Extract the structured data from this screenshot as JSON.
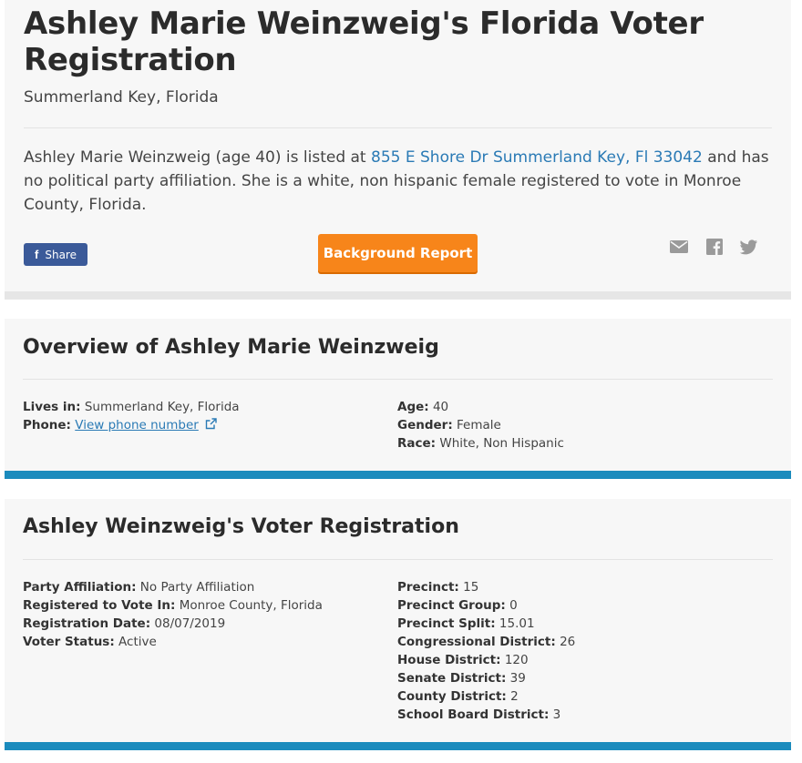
{
  "header": {
    "title": "Ashley Marie Weinzweig's Florida Voter Registration",
    "location": "Summerland Key, Florida",
    "desc_before": "Ashley Marie Weinzweig (age 40) is listed at ",
    "address_link": "855 E Shore Dr Summerland Key, Fl 33042",
    "desc_after": " and has no political party affiliation. She is a white, non hispanic female registered to vote in Monroe County, Florida.",
    "share_label": "Share",
    "background_report_label": "Background Report",
    "social_icons": [
      "mail-icon",
      "facebook-icon",
      "twitter-icon"
    ]
  },
  "overview": {
    "title": "Overview of Ashley Marie Weinzweig",
    "lives_in_label": "Lives in:",
    "lives_in_value": "Summerland Key, Florida",
    "phone_label": "Phone:",
    "phone_link": "View phone number",
    "age_label": "Age:",
    "age_value": "40",
    "gender_label": "Gender:",
    "gender_value": "Female",
    "race_label": "Race:",
    "race_value": "White, Non Hispanic"
  },
  "registration": {
    "title": "Ashley Weinzweig's Voter Registration",
    "left": [
      {
        "label": "Party Affiliation:",
        "value": "No Party Affiliation"
      },
      {
        "label": "Registered to Vote In:",
        "value": "Monroe County, Florida"
      },
      {
        "label": "Registration Date:",
        "value": "08/07/2019"
      },
      {
        "label": "Voter Status:",
        "value": "Active"
      }
    ],
    "right": [
      {
        "label": "Precinct:",
        "value": "15"
      },
      {
        "label": "Precinct Group:",
        "value": "0"
      },
      {
        "label": "Precinct Split:",
        "value": "15.01"
      },
      {
        "label": "Congressional District:",
        "value": "26"
      },
      {
        "label": "House District:",
        "value": "120"
      },
      {
        "label": "Senate District:",
        "value": "39"
      },
      {
        "label": "County District:",
        "value": "2"
      },
      {
        "label": "School Board District:",
        "value": "3"
      }
    ]
  },
  "colors": {
    "accent_blue": "#1b8bbd",
    "link_blue": "#2a7ab5",
    "orange": "#f7851a",
    "facebook_blue": "#3b5a99"
  }
}
